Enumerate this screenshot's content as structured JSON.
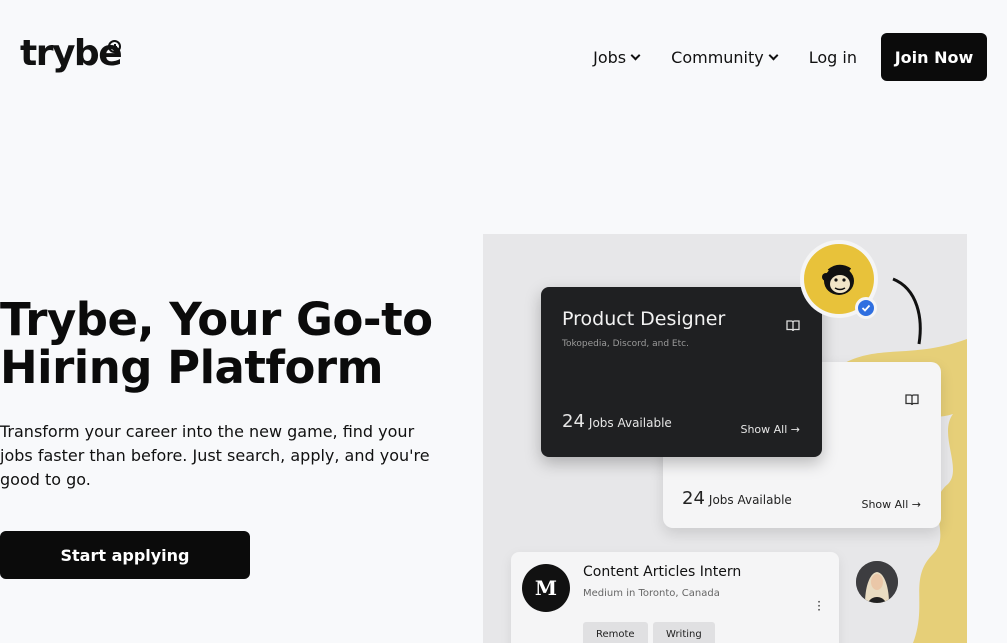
{
  "header": {
    "logo": "trybe",
    "nav": {
      "jobs": "Jobs",
      "community": "Community",
      "login": "Log in",
      "join": "Join Now"
    }
  },
  "hero": {
    "title_line1": "Trybe, Your Go-to",
    "title_line2": "Hiring Platform",
    "subtitle_line1": "Transform your career into the new game, find your",
    "subtitle_line2": "jobs faster than before. Just search, apply, and you're",
    "subtitle_line3": "good to go.",
    "cta": "Start applying"
  },
  "illustration": {
    "featured_card": {
      "title": "Product Designer",
      "subtitle": "Tokopedia, Discord, and Etc.",
      "count": "24",
      "count_label": "Jobs Available",
      "action": "Show All →"
    },
    "secondary_card": {
      "count": "24",
      "count_label": "Jobs Available",
      "action": "Show All →"
    },
    "intern_card": {
      "logo_letter": "M",
      "title": "Content Articles Intern",
      "company": "Medium",
      "location_prefix": "in",
      "location": "Toronto, Canada",
      "tags": [
        "Remote",
        "Writing"
      ]
    }
  },
  "colors": {
    "primary": "#0b0b0b",
    "background": "#f8f9fb",
    "accent_yellow": "#e8c23a",
    "verified_blue": "#2f6fe0"
  }
}
